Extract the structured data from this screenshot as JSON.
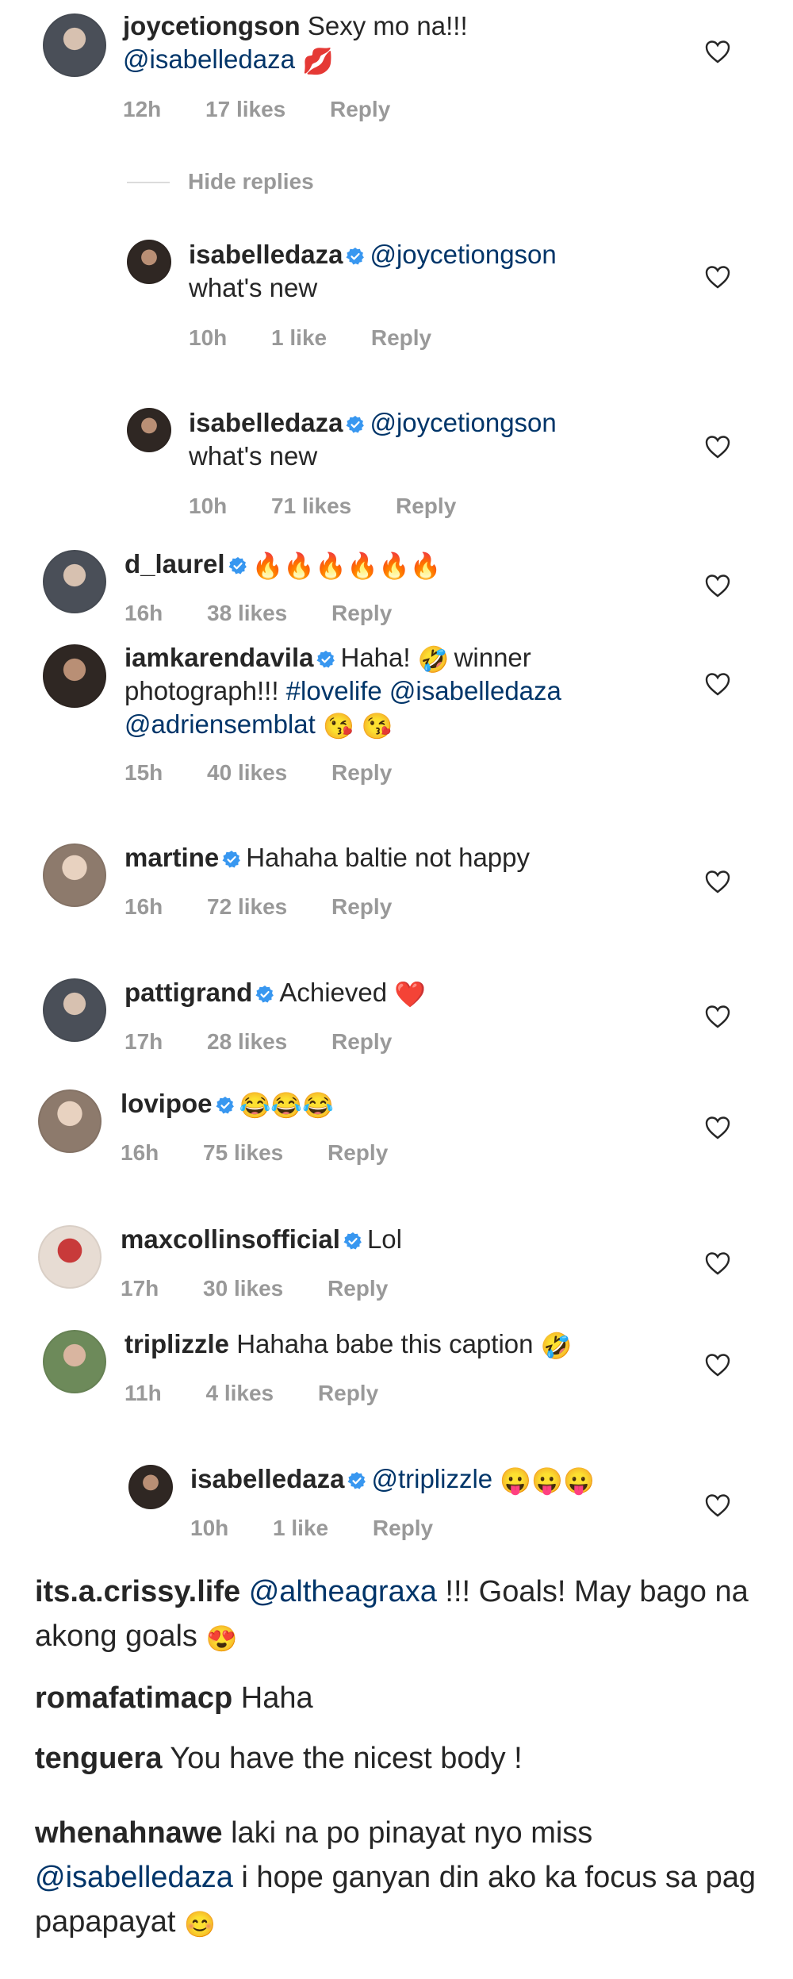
{
  "comments": [
    {
      "user": "joycetiongson",
      "verified": false,
      "text": "Sexy mo na!!!",
      "mention": "@isabelledaza",
      "emoji": "💋",
      "time": "12h",
      "likes": "17 likes",
      "reply": "Reply"
    },
    {
      "replies_toggle": "Hide replies"
    },
    {
      "user": "isabelledaza",
      "verified": true,
      "mention": "@joycetiongson",
      "text": "what's new",
      "time": "10h",
      "likes": "1 like",
      "reply": "Reply"
    },
    {
      "user": "isabelledaza",
      "verified": true,
      "mention": "@joycetiongson",
      "text": "what's new",
      "time": "10h",
      "likes": "71 likes",
      "reply": "Reply"
    },
    {
      "user": "d_laurel",
      "verified": true,
      "emoji": "🔥🔥🔥🔥🔥🔥",
      "time": "16h",
      "likes": "38 likes",
      "reply": "Reply"
    },
    {
      "user": "iamkarendavila",
      "verified": true,
      "text": "Haha!",
      "emoji1": "🤣",
      "text2": "winner photograph!!!",
      "tag": "#lovelife",
      "mention": "@isabelledaza",
      "mention2": "@adriensemblat",
      "emoji2": "😘 😘",
      "time": "15h",
      "likes": "40 likes",
      "reply": "Reply"
    },
    {
      "user": "martine",
      "verified": true,
      "text": "Hahaha baltie not happy",
      "time": "16h",
      "likes": "72 likes",
      "reply": "Reply"
    },
    {
      "user": "pattigrand",
      "verified": true,
      "text": "Achieved",
      "emoji": "❤️",
      "time": "17h",
      "likes": "28 likes",
      "reply": "Reply"
    },
    {
      "user": "lovipoe",
      "verified": true,
      "emoji": "😂😂😂",
      "time": "16h",
      "likes": "75 likes",
      "reply": "Reply"
    },
    {
      "user": "maxcollinsofficial",
      "verified": true,
      "text": "Lol",
      "time": "17h",
      "likes": "30 likes",
      "reply": "Reply"
    },
    {
      "user": "triplizzle",
      "verified": false,
      "text": "Hahaha babe this caption",
      "emoji": "🤣",
      "time": "11h",
      "likes": "4 likes",
      "reply": "Reply"
    },
    {
      "user": "isabelledaza",
      "verified": true,
      "mention": "@triplizzle",
      "emoji": "😛😛😛",
      "time": "10h",
      "likes": "1 like",
      "reply": "Reply"
    }
  ],
  "plain_comments": [
    {
      "user": "its.a.crissy.life",
      "mention": "@altheagraxa",
      "text": "!!! Goals! May bago na akong goals",
      "emoji": "😍"
    },
    {
      "user": "romafatimacp",
      "text": "Haha"
    },
    {
      "user": "tenguera",
      "text": "You have the nicest body !"
    },
    {
      "user": "whenahnawe",
      "text": "laki na po pinayat nyo miss",
      "mention": "@isabelledaza",
      "text2": "i hope ganyan din ako ka focus sa pag papapayat",
      "emoji": "😊"
    }
  ],
  "colors": {
    "username": "#262626",
    "mention": "#003569",
    "meta": "#999999",
    "verified": "#3897f0"
  }
}
